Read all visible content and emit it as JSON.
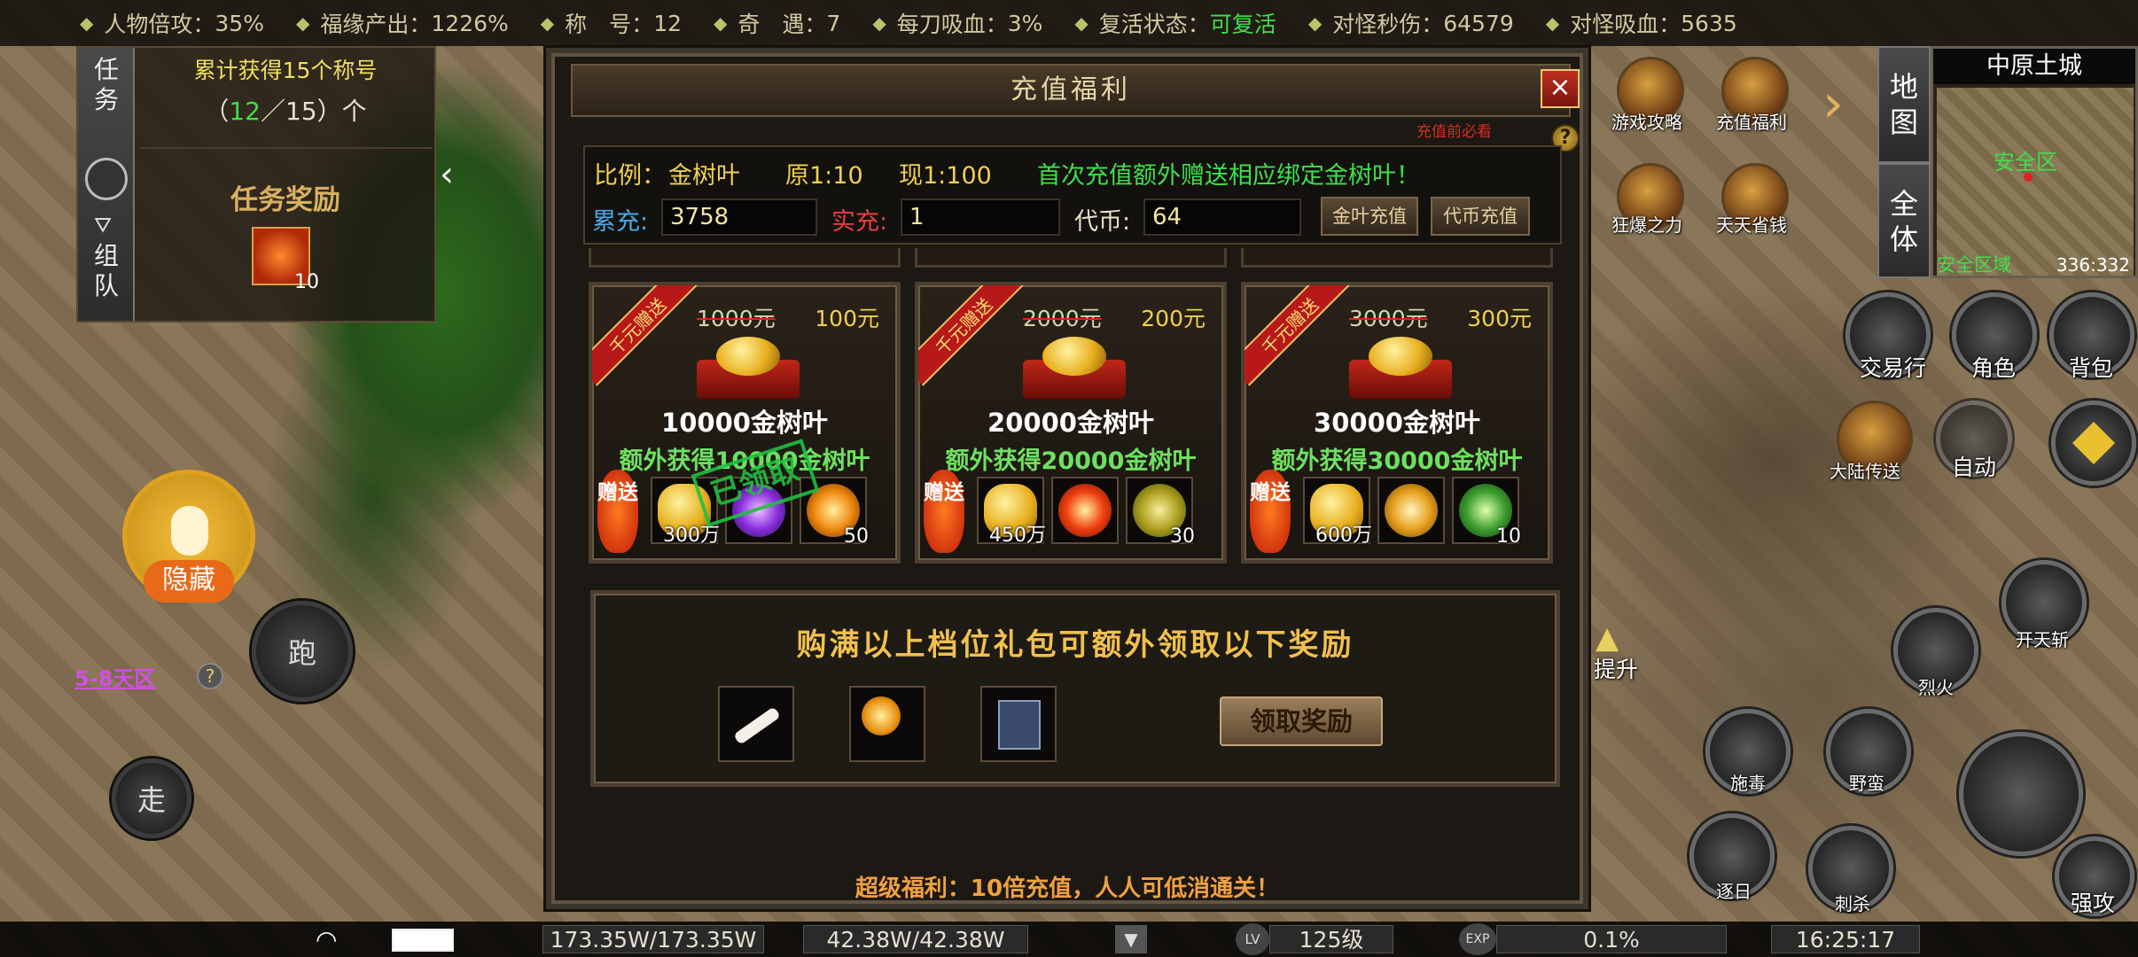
{
  "top_stats": [
    {
      "label": "人物倍攻：",
      "value": "35%"
    },
    {
      "label": "福缘产出：",
      "value": "1226%"
    },
    {
      "label": "称　号：",
      "value": "12"
    },
    {
      "label": "奇　遇：",
      "value": "7"
    },
    {
      "label": "每刀吸血：",
      "value": "3%"
    },
    {
      "label": "复活状态：",
      "value": "可复活",
      "highlight": true
    },
    {
      "label": "对怪秒伤：",
      "value": "64579"
    },
    {
      "label": "对怪吸血：",
      "value": "5635"
    }
  ],
  "quest": {
    "tab_quest": "任务",
    "tab_team": "组队",
    "title_line": "累计获得15个称号",
    "progress_open": "（",
    "progress_current": "12",
    "progress_sep": "／15）个",
    "reward_heading": "任务奖励",
    "reward_count": "10"
  },
  "left_hud": {
    "hide_label": "隐藏",
    "run_label": "跑",
    "walk_label": "走",
    "zone_link": "5-8天区"
  },
  "dialog": {
    "title": "充值福利",
    "close": "×",
    "help_tip": "充值前必看",
    "help_icon": "?",
    "ratio_label": "比例：",
    "ratio_currency": "金树叶",
    "orig_ratio": "原1:10",
    "now_ratio": "现1:100",
    "first_charge_note": "首次充值额外赠送相应绑定金树叶！",
    "total_label": "累充:",
    "total_value": "3758",
    "actual_label": "实充:",
    "actual_value": "1",
    "token_label": "代币:",
    "token_value": "64",
    "btn_leaf_charge": "金叶充值",
    "btn_token_charge": "代币充值",
    "cards": [
      {
        "ribbon": "千元赠送",
        "old_price": "1000元",
        "new_price": "100元",
        "amount": "10000金树叶",
        "extra": "额外获得10000金树叶",
        "gift_label": "赠送",
        "items": [
          {
            "icon": "gold-ingot-icon",
            "count": "300万"
          },
          {
            "icon": "purple-orb-icon",
            "count": ""
          },
          {
            "icon": "fire-orb-icon",
            "count": "50"
          }
        ],
        "claimed": true
      },
      {
        "ribbon": "千元赠送",
        "old_price": "2000元",
        "new_price": "200元",
        "amount": "20000金树叶",
        "extra": "额外获得20000金树叶",
        "gift_label": "赠送",
        "items": [
          {
            "icon": "gold-ingot-icon",
            "count": "450万"
          },
          {
            "icon": "flame-icon",
            "count": ""
          },
          {
            "icon": "wing-icon",
            "count": "30"
          }
        ],
        "claimed": false
      },
      {
        "ribbon": "千元赠送",
        "old_price": "3000元",
        "new_price": "300元",
        "amount": "30000金树叶",
        "extra": "额外获得30000金树叶",
        "gift_label": "赠送",
        "items": [
          {
            "icon": "gold-ingot-icon",
            "count": "600万"
          },
          {
            "icon": "gold-burst-icon",
            "count": ""
          },
          {
            "icon": "green-orb-icon",
            "count": "10"
          }
        ],
        "claimed": false
      }
    ],
    "claimed_stamp": "已领取",
    "bonus_title": "购满以上档位礼包可额外领取以下奖励",
    "bonus_items": [
      "scroll-icon",
      "scepter-icon",
      "book-icon"
    ],
    "claim_button": "领取奖励",
    "footer": "超级福利：10倍充值，人人可低消通关！"
  },
  "right_hud": {
    "icons": [
      "游戏攻略",
      "充值福利",
      "狂爆之力",
      "天天省钱"
    ],
    "side_tabs": [
      "地图",
      "全体"
    ],
    "map_name": "中原土城",
    "map_safe": "安全区",
    "map_zone": "安全区域",
    "coords": "336:332",
    "menu": [
      "交易行",
      "角色",
      "背包"
    ],
    "auto": "自动",
    "teleport": "大陆传送",
    "raise": "提升",
    "skills": [
      "开天斩",
      "烈火",
      "施毒",
      "野蛮",
      "逐日",
      "刺杀",
      "强攻"
    ]
  },
  "bottom": {
    "hp": "173.35W/173.35W",
    "mp": "42.38W/42.38W",
    "lv_badge": "LV",
    "level": "125级",
    "exp_badge": "EXP",
    "exp": "0.1%",
    "time": "16:25:17"
  },
  "colors": {
    "accent_gold": "#f0c050",
    "green": "#3ee04a",
    "panel_bg": "#1c1813"
  }
}
